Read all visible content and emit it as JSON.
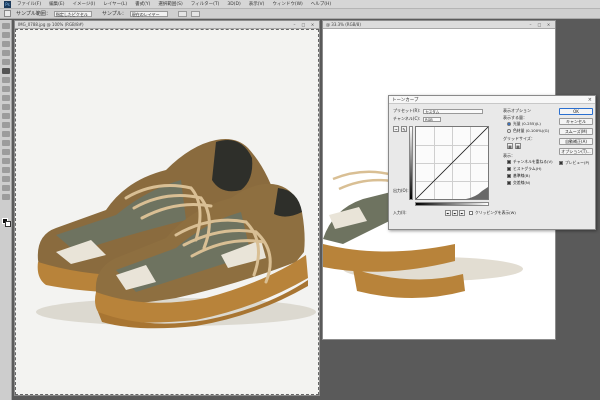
{
  "menubar": {
    "items": [
      "ファイル(F)",
      "編集(E)",
      "イメージ(I)",
      "レイヤー(L)",
      "書式(Y)",
      "選択範囲(S)",
      "フィルター(T)",
      "3D(D)",
      "表示(V)",
      "ウィンドウ(W)",
      "ヘルプ(H)"
    ]
  },
  "optionsbar": {
    "sample_label": "サンプル範囲：",
    "sample_value": "指定したピクセル",
    "layer_label": "サンプル：",
    "layer_value": "現在のレイヤー"
  },
  "windows": {
    "left_title": "IMG_0788.jpg @ 100% (RGB/8#)",
    "right_title": "@ 33.3% (RGB/8)"
  },
  "dialog": {
    "title": "トーンカーブ",
    "preset_label": "プリセット(R):",
    "preset_value": "カスタム",
    "channel_label": "チャンネル(C):",
    "channel_value": "RGB",
    "display_options": "表示オプション",
    "show_amount": "表示する量：",
    "light_label": "光量 (0-255)(L)",
    "ink_label": "色材量 (0-100%)(G)",
    "grid_label": "グリッドサイズ：",
    "show_label": "表示：",
    "channel_overlay": "チャンネルを重ねる(V)",
    "histogram": "ヒストグラム(H)",
    "baseline": "基準線(B)",
    "intersection": "交差線(N)",
    "output_label": "出力(O):",
    "input_label": "入力(I):",
    "clipping": "クリッピングを表示(W)",
    "ok": "OK",
    "cancel": "キャンセル",
    "smooth": "スムーズ(M)",
    "auto": "自動補正(A)",
    "options": "オプション(T)...",
    "preview": "プレビュー(P)"
  },
  "colors": {
    "accent": "#2a6fd0",
    "workspace": "#5a5a5a",
    "shoe_sole": "#b8833a",
    "shoe_upper": "#6e7360",
    "shoe_lace": "#d9bf94"
  }
}
